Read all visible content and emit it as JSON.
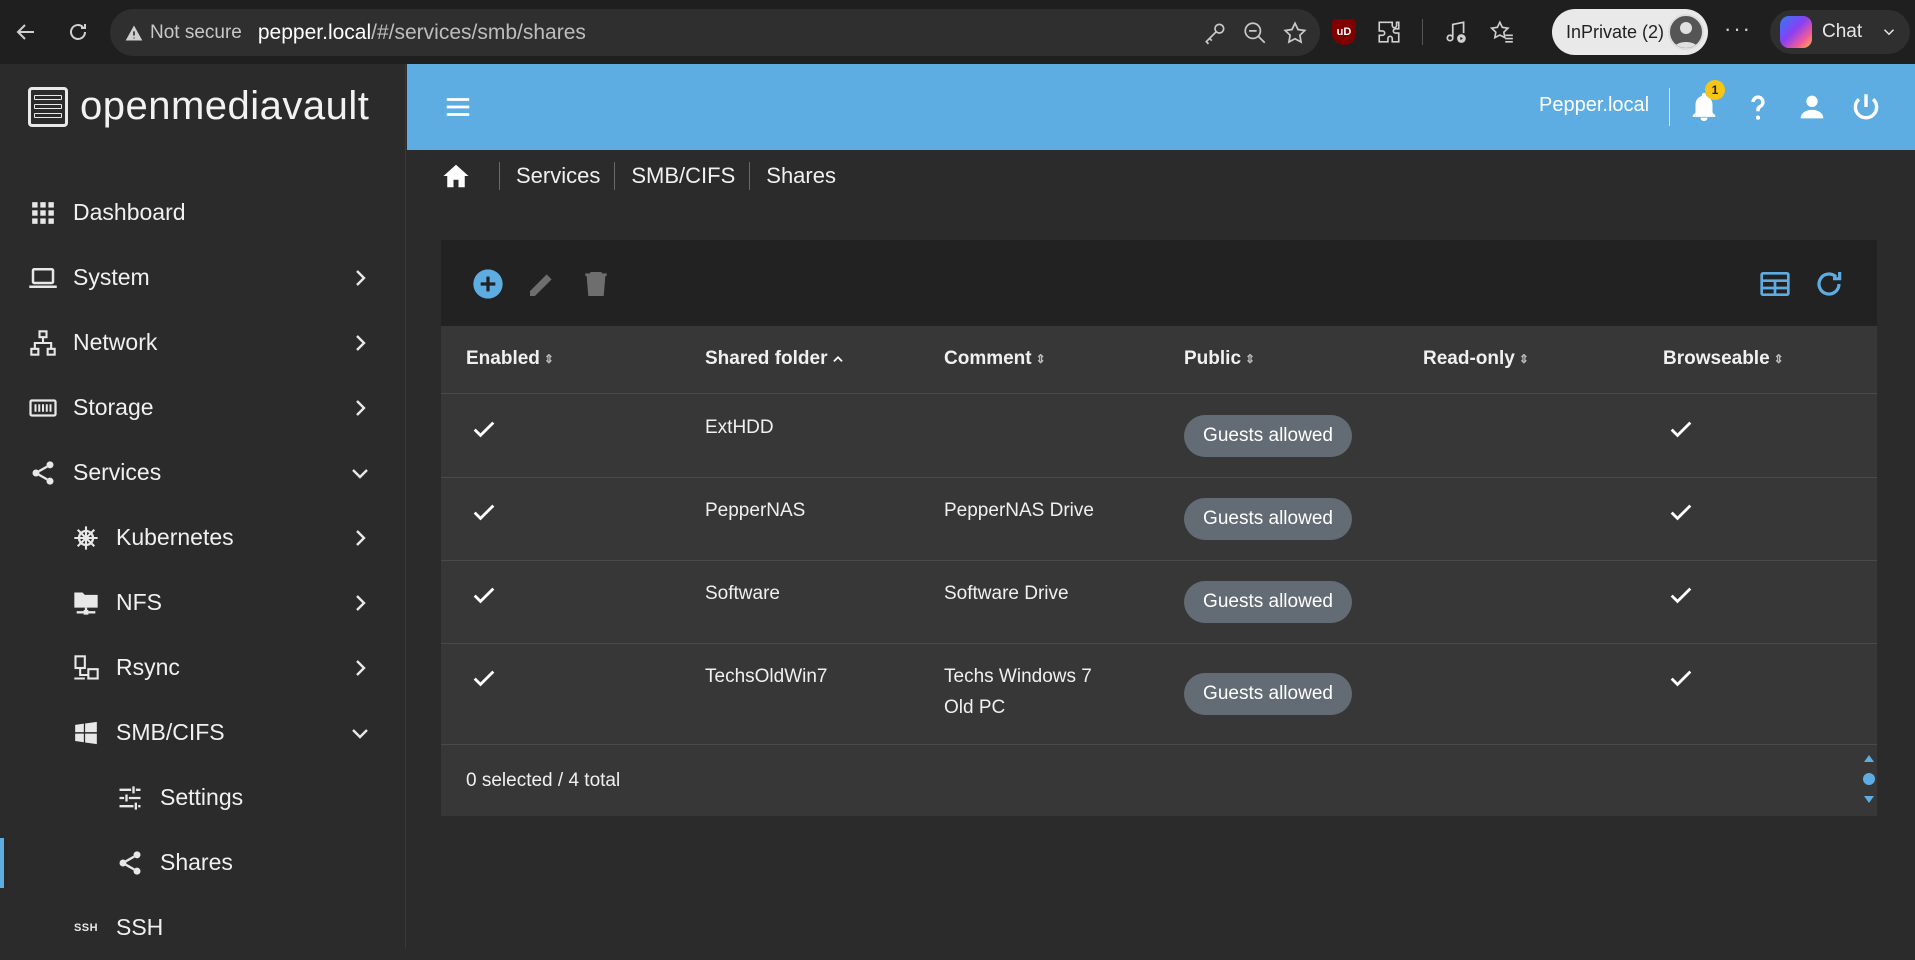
{
  "browser": {
    "not_secure_label": "Not secure",
    "url_host": "pepper.local",
    "url_rest": "/#/services/smb/shares",
    "ublock_label": "uD",
    "inprivate_label": "InPrivate (2)",
    "chat_label": "Chat",
    "more_label": "···"
  },
  "app": {
    "logo_text": "openmediavault",
    "hostname": "Pepper.local",
    "notification_count": "1"
  },
  "sidebar": {
    "items": [
      {
        "label": "Dashboard",
        "icon": "grid-icon"
      },
      {
        "label": "System",
        "icon": "laptop-icon"
      },
      {
        "label": "Network",
        "icon": "network-icon"
      },
      {
        "label": "Storage",
        "icon": "storage-icon"
      },
      {
        "label": "Services",
        "icon": "share-icon"
      },
      {
        "label": "Kubernetes",
        "icon": "helm-icon"
      },
      {
        "label": "NFS",
        "icon": "folder-network-icon"
      },
      {
        "label": "Rsync",
        "icon": "rsync-icon"
      },
      {
        "label": "SMB/CIFS",
        "icon": "windows-icon"
      },
      {
        "label": "Settings",
        "icon": "tune-icon"
      },
      {
        "label": "Shares",
        "icon": "share-icon"
      },
      {
        "label": "SSH",
        "icon": "ssh-icon"
      }
    ],
    "ssh_glyph": "SSH"
  },
  "breadcrumb": [
    "Services",
    "SMB/CIFS",
    "Shares"
  ],
  "table": {
    "columns": [
      "Enabled",
      "Shared folder",
      "Comment",
      "Public",
      "Read-only",
      "Browseable"
    ],
    "sort_column": "Shared folder",
    "rows": [
      {
        "enabled": true,
        "folder": "ExtHDD",
        "comment": "",
        "public": "Guests allowed",
        "readonly": false,
        "browseable": true
      },
      {
        "enabled": true,
        "folder": "PepperNAS",
        "comment": "PepperNAS Drive",
        "public": "Guests allowed",
        "readonly": false,
        "browseable": true
      },
      {
        "enabled": true,
        "folder": "Software",
        "comment": "Software Drive",
        "public": "Guests allowed",
        "readonly": false,
        "browseable": true
      },
      {
        "enabled": true,
        "folder": "TechsOldWin7",
        "comment_line1": "Techs Windows 7",
        "comment_line2": "Old PC",
        "public": "Guests allowed",
        "readonly": false,
        "browseable": true
      }
    ],
    "footer": "0 selected / 4 total"
  },
  "colors": {
    "accent": "#5dade2",
    "sidebar_bg": "#2b2b2b",
    "card_bg": "#373737",
    "toolbar_bg": "#222222",
    "chip_bg": "#636c74"
  }
}
